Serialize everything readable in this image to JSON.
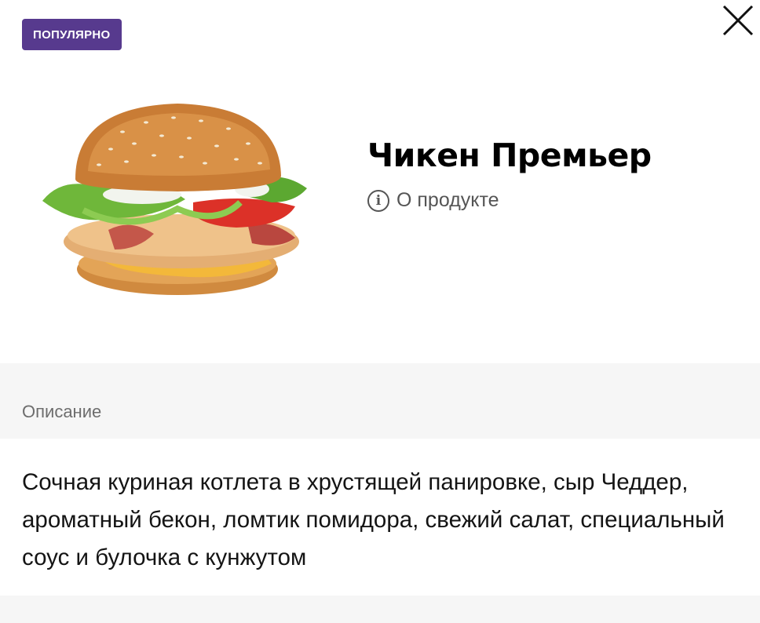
{
  "badge": {
    "label": "ПОПУЛЯРНО",
    "color": "#573a8e"
  },
  "close": {
    "icon": "close-icon"
  },
  "product": {
    "image": "burger-image",
    "title": "Чикен Премьер",
    "about_label": "О продукте",
    "about_icon": "info-icon"
  },
  "description": {
    "heading": "Описание",
    "text": "Сочная куриная котлета в хрустящей панировке, сыр Чеддер, ароматный бекон, ломтик помидора, свежий салат, специальный соус и булочка с кунжутом"
  }
}
